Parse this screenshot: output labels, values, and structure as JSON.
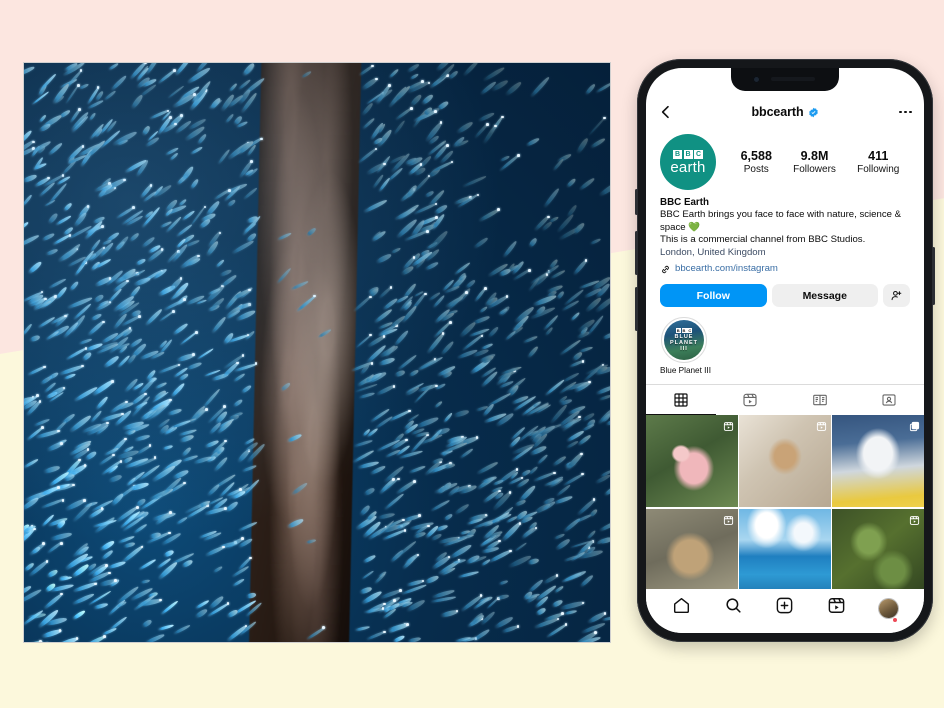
{
  "background": {
    "top_color": "#FCE6E0",
    "bottom_color": "#FCF8DC"
  },
  "hero_photo": {
    "alt": "School of blue fish swimming around a barnacle-covered pier piling underwater",
    "border_color": "#cfcfcf"
  },
  "phone": {
    "frame_color": "#15171a",
    "app": {
      "header": {
        "back_icon": "chevron-left-icon",
        "username": "bbcearth",
        "verified_icon": "verified-badge-icon",
        "verified_color": "#1D9BF0",
        "menu_icon": "more-options-icon"
      },
      "profile": {
        "avatar": {
          "icon": "bbc-earth-logo",
          "brand_color": "#109183",
          "bbc_letters": [
            "B",
            "B",
            "C"
          ],
          "word": "earth"
        },
        "stats": [
          {
            "num": "6,588",
            "label": "Posts"
          },
          {
            "num": "9.8M",
            "label": "Followers"
          },
          {
            "num": "411",
            "label": "Following"
          }
        ],
        "display_name": "BBC Earth",
        "bio_line_1": "BBC Earth brings you face to face with nature, science &",
        "bio_line_2": "space 💚",
        "bio_line_3": "This is a commercial channel from BBC Studios.",
        "location": "London, United Kingdom",
        "link_icon": "link-chain-icon",
        "link_text": "bbcearth.com/instagram",
        "link_color": "#3a6ea5"
      },
      "actions": {
        "follow_label": "Follow",
        "follow_color": "#0095F6",
        "message_label": "Message",
        "message_color": "#EFEFEF",
        "add_user_icon": "add-person-icon"
      },
      "highlights": [
        {
          "title": "Blue Planet III",
          "cover_text": [
            "BLUE",
            "PLANET",
            "III"
          ]
        }
      ],
      "tabs": [
        {
          "name": "grid",
          "icon": "grid-icon",
          "active": true
        },
        {
          "name": "reels",
          "icon": "reels-icon",
          "active": false
        },
        {
          "name": "guides",
          "icon": "guides-book-icon",
          "active": false
        },
        {
          "name": "tagged",
          "icon": "tagged-person-icon",
          "active": false
        }
      ],
      "posts": [
        {
          "alt": "Pink flamingo preening in green grass",
          "art": "art-flamingo",
          "overlay": "reel-icon"
        },
        {
          "alt": "Close-up of a mosquito on pale skin",
          "art": "art-mosquito",
          "overlay": "reel-icon"
        },
        {
          "alt": "Close-up of a blue tit bird head on yellow",
          "art": "art-bluetit",
          "overlay": "carousel-icon"
        },
        {
          "alt": "Quokka face close-up on sandy ground",
          "art": "art-quokka",
          "overlay": "reel-icon"
        },
        {
          "alt": "Turquoise ocean water with clouds above",
          "art": "art-ocean",
          "overlay": "none"
        },
        {
          "alt": "Green mossy forest floor from above",
          "art": "art-moss",
          "overlay": "reel-icon"
        }
      ],
      "bottom_nav": [
        {
          "name": "home",
          "icon": "home-icon"
        },
        {
          "name": "search",
          "icon": "search-icon"
        },
        {
          "name": "create",
          "icon": "plus-square-icon"
        },
        {
          "name": "reels",
          "icon": "reels-icon"
        },
        {
          "name": "profile",
          "icon": "profile-avatar-icon",
          "badge": true
        }
      ]
    }
  }
}
